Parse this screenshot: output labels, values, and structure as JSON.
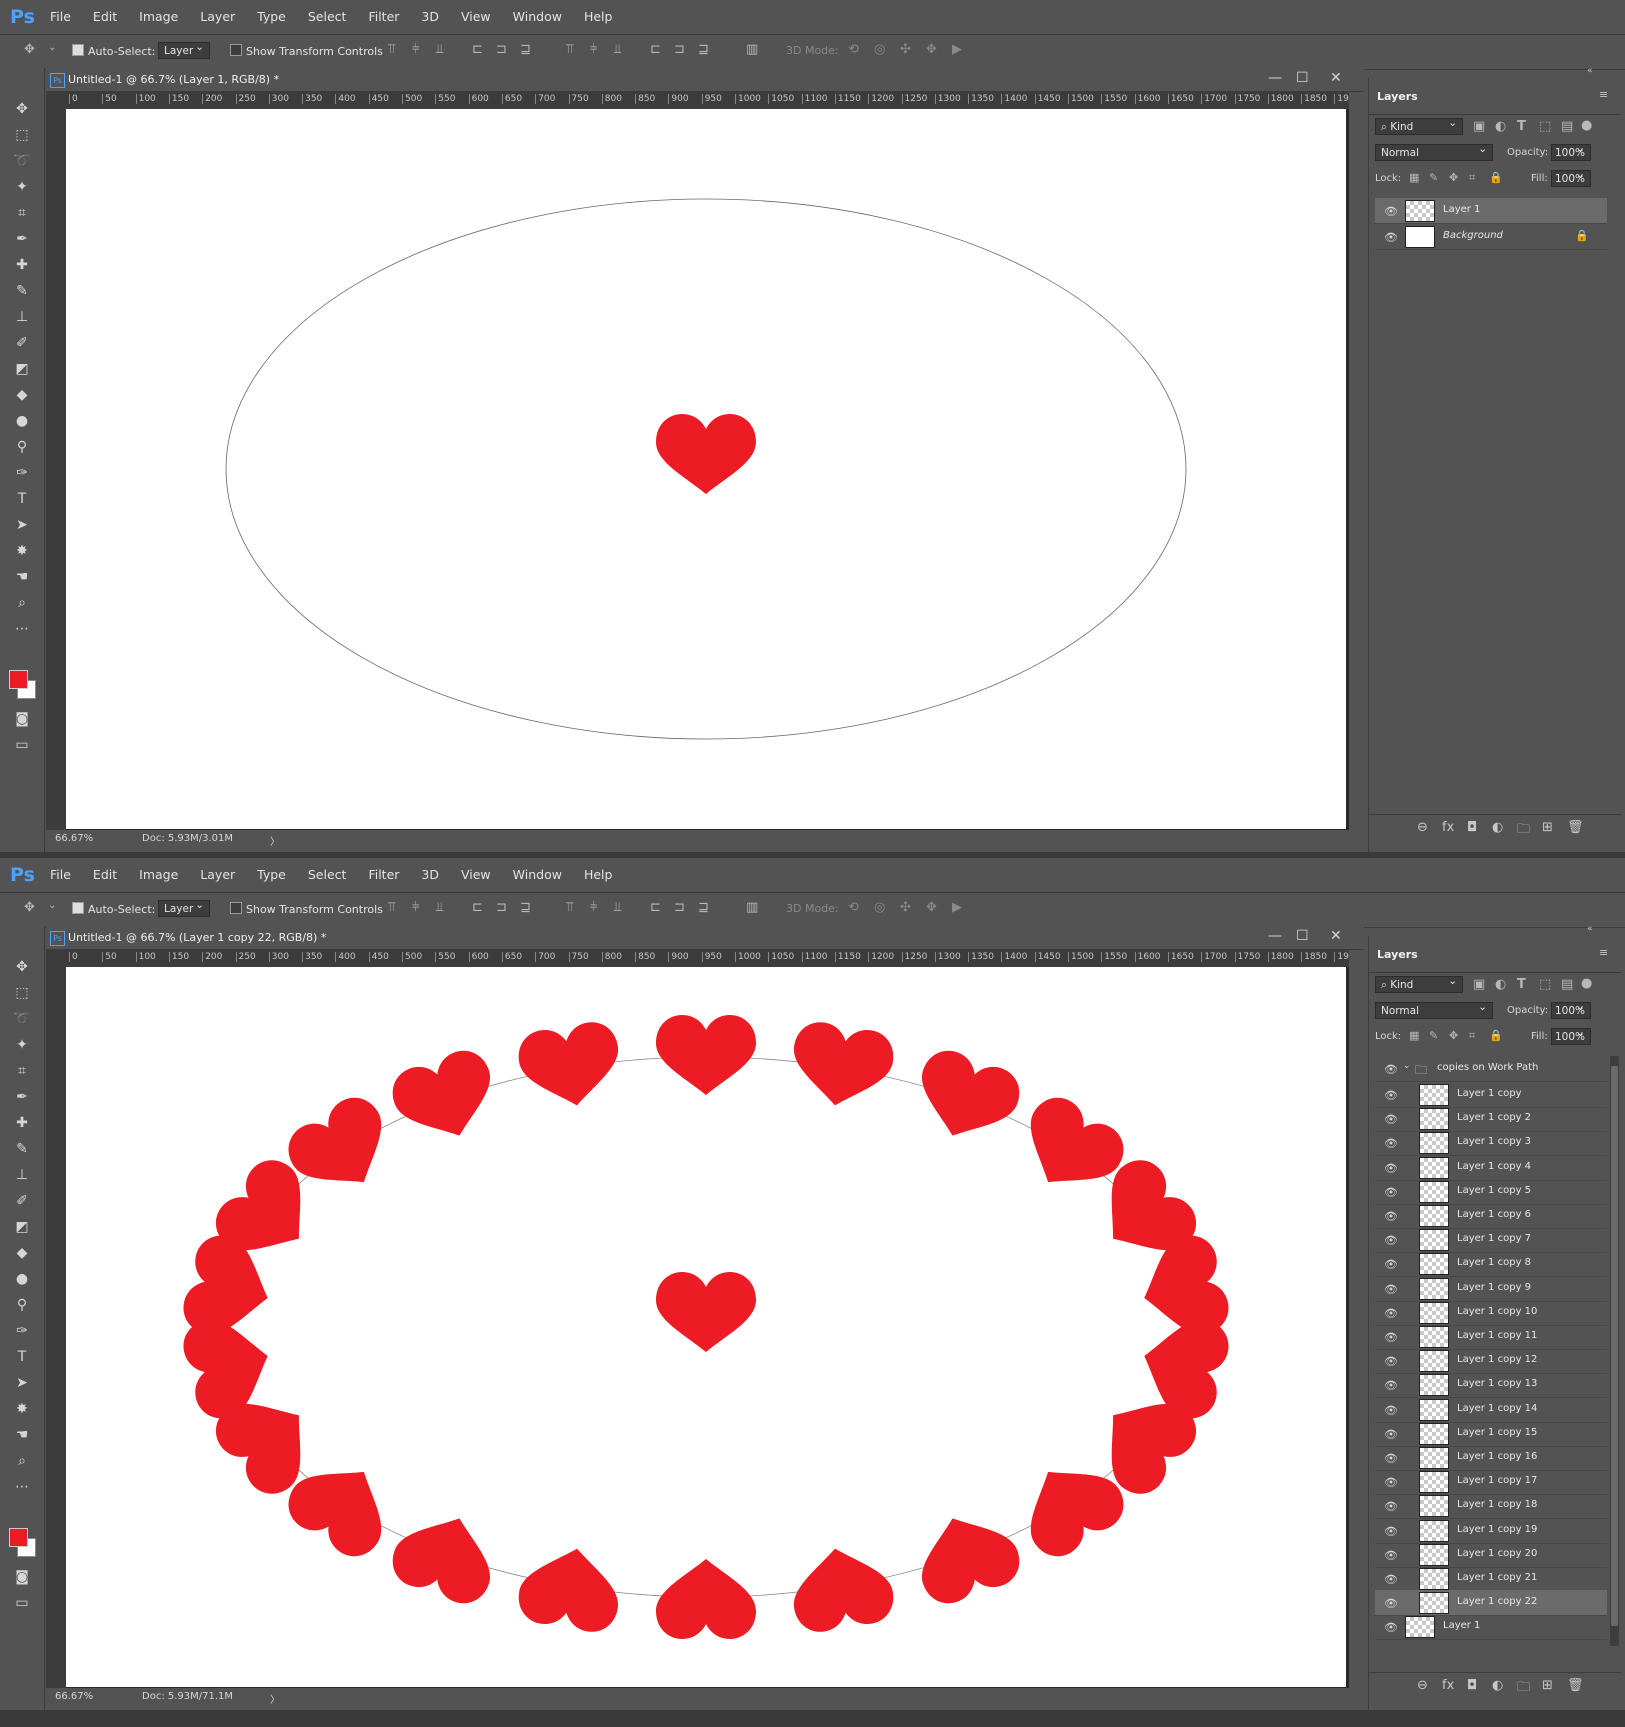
{
  "app": {
    "logo": "Ps"
  },
  "menu": [
    "File",
    "Edit",
    "Image",
    "Layer",
    "Type",
    "Select",
    "Filter",
    "3D",
    "View",
    "Window",
    "Help"
  ],
  "options": {
    "auto_select": "Auto-Select:",
    "auto_select_value": "Layer",
    "show_transform": "Show Transform Controls",
    "mode_3d": "3D Mode:"
  },
  "ruler_ticks": [
    "0",
    "50",
    "100",
    "150",
    "200",
    "250",
    "300",
    "350",
    "400",
    "450",
    "500",
    "550",
    "600",
    "650",
    "700",
    "750",
    "800",
    "850",
    "900",
    "950",
    "1000",
    "1050",
    "1100",
    "1150",
    "1200",
    "1250",
    "1300",
    "1350",
    "1400",
    "1450",
    "1500",
    "1550",
    "1600",
    "1650",
    "1700",
    "1750",
    "1800",
    "1850",
    "19"
  ],
  "colors": {
    "foreground": "#ed1c24",
    "background": "#ffffff",
    "heart": "#ed1c24"
  },
  "panel": {
    "tab": "Layers",
    "kind": "Kind",
    "blend": "Normal",
    "opacity_label": "Opacity:",
    "opacity": "100%",
    "lock_label": "Lock:",
    "fill_label": "Fill:",
    "fill": "100%"
  },
  "window1": {
    "title": "Untitled-1 @ 66.7% (Layer 1, RGB/8) *",
    "zoom": "66.67%",
    "doc": "Doc: 5.93M/3.01M",
    "layers": [
      {
        "name": "Layer 1",
        "selected": true
      },
      {
        "name": "Background",
        "italic": true,
        "locked": true
      }
    ]
  },
  "window2": {
    "title": "Untitled-1 @ 66.7% (Layer 1 copy 22, RGB/8) *",
    "zoom": "66.67%",
    "doc": "Doc: 5.93M/71.1M",
    "group": "copies on Work Path",
    "layers": [
      "Layer 1 copy",
      "Layer 1 copy 2",
      "Layer 1 copy 3",
      "Layer 1 copy 4",
      "Layer 1 copy 5",
      "Layer 1 copy 6",
      "Layer 1 copy 7",
      "Layer 1 copy 8",
      "Layer 1 copy 9",
      "Layer 1 copy 10",
      "Layer 1 copy 11",
      "Layer 1 copy 12",
      "Layer 1 copy 13",
      "Layer 1 copy 14",
      "Layer 1 copy 15",
      "Layer 1 copy 16",
      "Layer 1 copy 17",
      "Layer 1 copy 18",
      "Layer 1 copy 19",
      "Layer 1 copy 20",
      "Layer 1 copy 21",
      "Layer 1 copy 22",
      "Layer 1"
    ],
    "selected_layer": "Layer 1 copy 22",
    "heart_copies": 22
  }
}
